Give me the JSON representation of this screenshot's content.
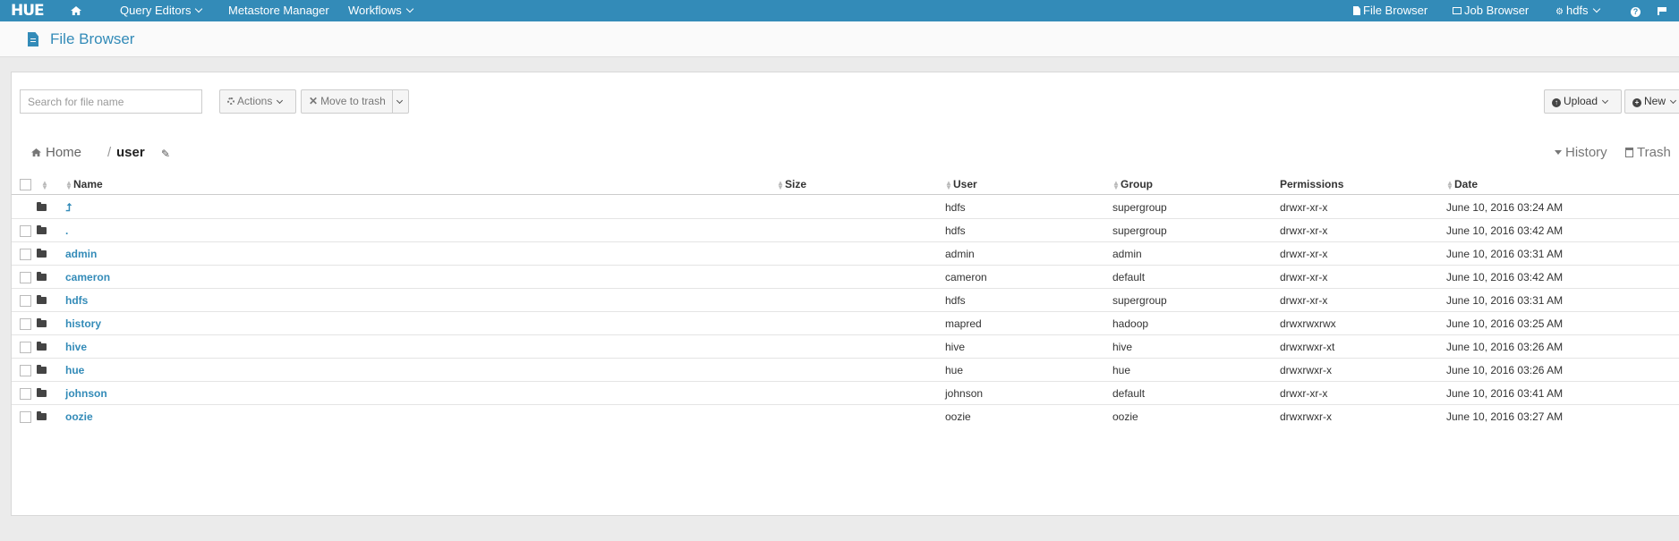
{
  "nav": {
    "logo": "HUE",
    "query_editors": "Query Editors",
    "metastore": "Metastore Manager",
    "workflows": "Workflows",
    "file_browser": "File Browser",
    "job_browser": "Job Browser",
    "user": "hdfs",
    "help_icon": "?"
  },
  "page": {
    "title": "File Browser"
  },
  "toolbar": {
    "search_placeholder": "Search for file name",
    "actions_label": "Actions",
    "move_to_trash_label": "Move to trash",
    "upload_label": "Upload",
    "new_label": "New"
  },
  "breadcrumb": {
    "home": "Home",
    "separator": "/",
    "current": "user",
    "history": "History",
    "trash": "Trash"
  },
  "table": {
    "columns": [
      "Name",
      "Size",
      "User",
      "Group",
      "Permissions",
      "Date"
    ],
    "rows": [
      {
        "name": "⮥",
        "size": "",
        "user": "hdfs",
        "group": "supergroup",
        "permissions": "drwxr-xr-x",
        "date": "June 10, 2016 03:24 AM"
      },
      {
        "name": ".",
        "size": "",
        "user": "hdfs",
        "group": "supergroup",
        "permissions": "drwxr-xr-x",
        "date": "June 10, 2016 03:42 AM"
      },
      {
        "name": "admin",
        "size": "",
        "user": "admin",
        "group": "admin",
        "permissions": "drwxr-xr-x",
        "date": "June 10, 2016 03:31 AM"
      },
      {
        "name": "cameron",
        "size": "",
        "user": "cameron",
        "group": "default",
        "permissions": "drwxr-xr-x",
        "date": "June 10, 2016 03:42 AM"
      },
      {
        "name": "hdfs",
        "size": "",
        "user": "hdfs",
        "group": "supergroup",
        "permissions": "drwxr-xr-x",
        "date": "June 10, 2016 03:31 AM"
      },
      {
        "name": "history",
        "size": "",
        "user": "mapred",
        "group": "hadoop",
        "permissions": "drwxrwxrwx",
        "date": "June 10, 2016 03:25 AM"
      },
      {
        "name": "hive",
        "size": "",
        "user": "hive",
        "group": "hive",
        "permissions": "drwxrwxr-xt",
        "date": "June 10, 2016 03:26 AM"
      },
      {
        "name": "hue",
        "size": "",
        "user": "hue",
        "group": "hue",
        "permissions": "drwxrwxr-x",
        "date": "June 10, 2016 03:26 AM"
      },
      {
        "name": "johnson",
        "size": "",
        "user": "johnson",
        "group": "default",
        "permissions": "drwxr-xr-x",
        "date": "June 10, 2016 03:41 AM"
      },
      {
        "name": "oozie",
        "size": "",
        "user": "oozie",
        "group": "oozie",
        "permissions": "drwxrwxr-x",
        "date": "June 10, 2016 03:27 AM"
      }
    ]
  },
  "colors": {
    "accent": "#338bb8",
    "nav_bg": "#338bb8"
  }
}
